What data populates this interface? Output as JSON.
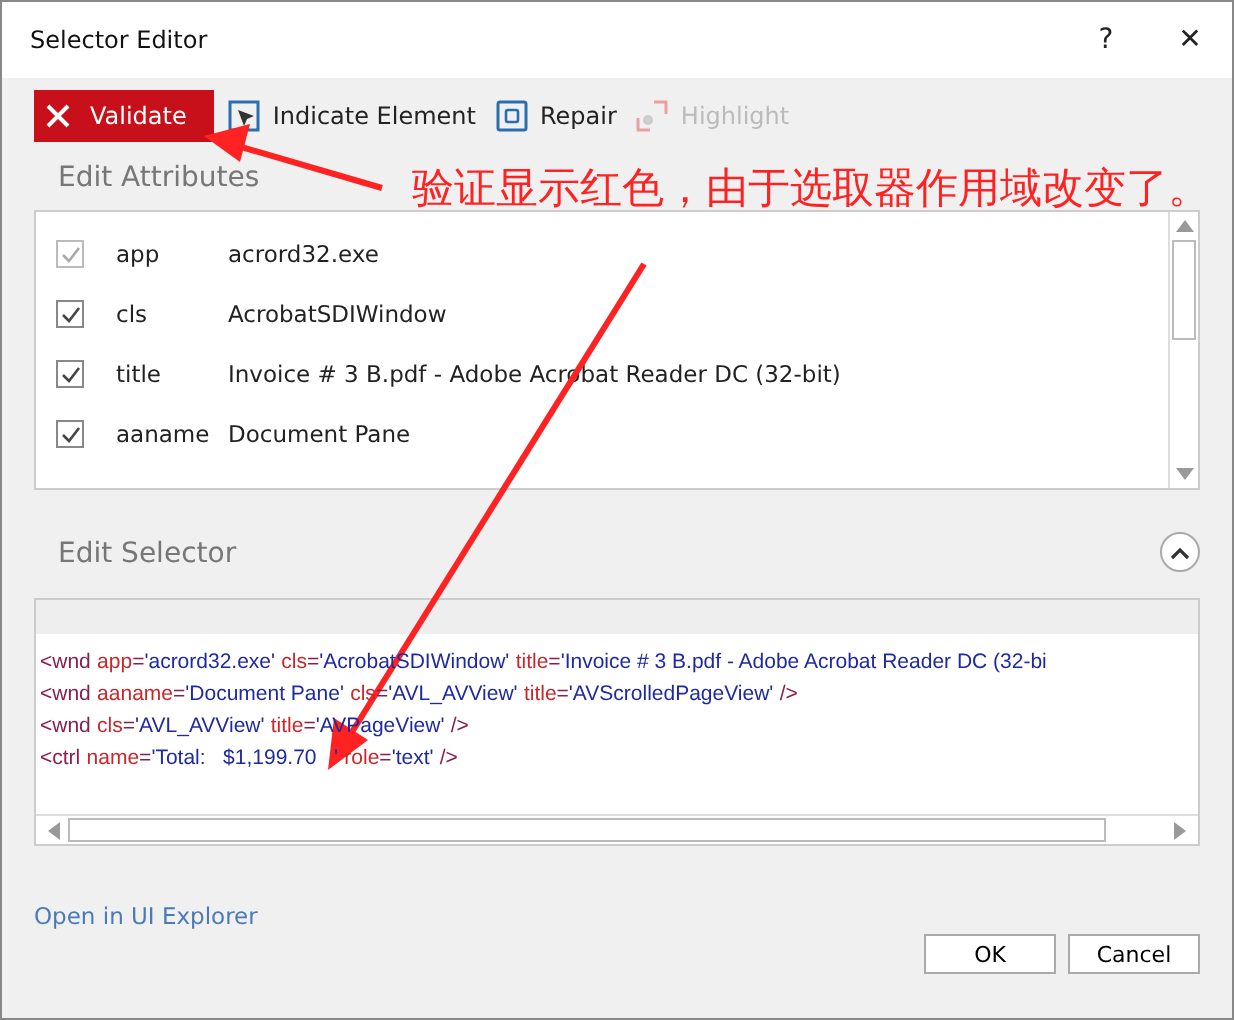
{
  "window": {
    "title": "Selector Editor",
    "help": "?",
    "close": "✕"
  },
  "toolbar": [
    {
      "kind": "validate",
      "label": "Validate",
      "error": true
    },
    {
      "kind": "indicate",
      "label": "Indicate Element",
      "disabled": false
    },
    {
      "kind": "repair",
      "label": "Repair",
      "disabled": false
    },
    {
      "kind": "highlight",
      "label": "Highlight",
      "disabled": true
    }
  ],
  "attributes": {
    "heading": "Edit Attributes",
    "rows": [
      {
        "name": "app",
        "value": "acrord32.exe",
        "checked": true,
        "disabled": true
      },
      {
        "name": "cls",
        "value": "AcrobatSDIWindow",
        "checked": true,
        "disabled": false
      },
      {
        "name": "title",
        "value": "Invoice # 3 B.pdf - Adobe Acrobat Reader DC (32-bit)",
        "checked": true,
        "disabled": false
      },
      {
        "name": "aaname",
        "value": "Document Pane",
        "checked": true,
        "disabled": false
      }
    ]
  },
  "selector": {
    "heading": "Edit Selector",
    "expanded": true,
    "lines": [
      [
        {
          "kind": "punct",
          "text": "<wnd"
        },
        {
          "kind": "attr",
          "text": "app"
        },
        {
          "kind": "punct",
          "text": "="
        },
        {
          "kind": "value",
          "text": "'acrord32.exe'"
        },
        {
          "kind": "attr",
          "text": "cls"
        },
        {
          "kind": "punct",
          "text": "="
        },
        {
          "kind": "value",
          "text": "'AcrobatSDIWindow'"
        },
        {
          "kind": "attr",
          "text": "title"
        },
        {
          "kind": "punct",
          "text": "="
        },
        {
          "kind": "value",
          "text": "'Invoice # 3 B.pdf - Adobe Acrobat Reader DC (32-bi"
        }
      ],
      [
        {
          "kind": "punct",
          "text": "<wnd"
        },
        {
          "kind": "attr",
          "text": "aaname"
        },
        {
          "kind": "punct",
          "text": "="
        },
        {
          "kind": "value",
          "text": "'Document Pane'"
        },
        {
          "kind": "attr",
          "text": "cls"
        },
        {
          "kind": "punct",
          "text": "="
        },
        {
          "kind": "value",
          "text": "'AVL_AVView'"
        },
        {
          "kind": "attr",
          "text": "title"
        },
        {
          "kind": "punct",
          "text": "="
        },
        {
          "kind": "value",
          "text": "'AVScrolledPageView'"
        },
        {
          "kind": "close",
          "text": "/>"
        }
      ],
      [
        {
          "kind": "punct",
          "text": "<wnd"
        },
        {
          "kind": "attr",
          "text": "cls"
        },
        {
          "kind": "punct",
          "text": "="
        },
        {
          "kind": "value",
          "text": "'AVL_AVView'"
        },
        {
          "kind": "attr",
          "text": "title"
        },
        {
          "kind": "punct",
          "text": "="
        },
        {
          "kind": "value",
          "text": "'AVPageView'"
        },
        {
          "kind": "close",
          "text": "/>"
        }
      ],
      [
        {
          "kind": "punct",
          "text": "<ctrl"
        },
        {
          "kind": "attr",
          "text": "name"
        },
        {
          "kind": "punct",
          "text": "="
        },
        {
          "kind": "value",
          "text": "'Total:   $1,199.70   '"
        },
        {
          "kind": "attr",
          "text": "role"
        },
        {
          "kind": "punct",
          "text": "="
        },
        {
          "kind": "value",
          "text": "'text'"
        },
        {
          "kind": "close",
          "text": "/>"
        }
      ]
    ]
  },
  "link": "Open in UI Explorer",
  "buttons": [
    "OK",
    "Cancel"
  ],
  "annotation": "验证显示红色，由于选取器作用域改变了。"
}
